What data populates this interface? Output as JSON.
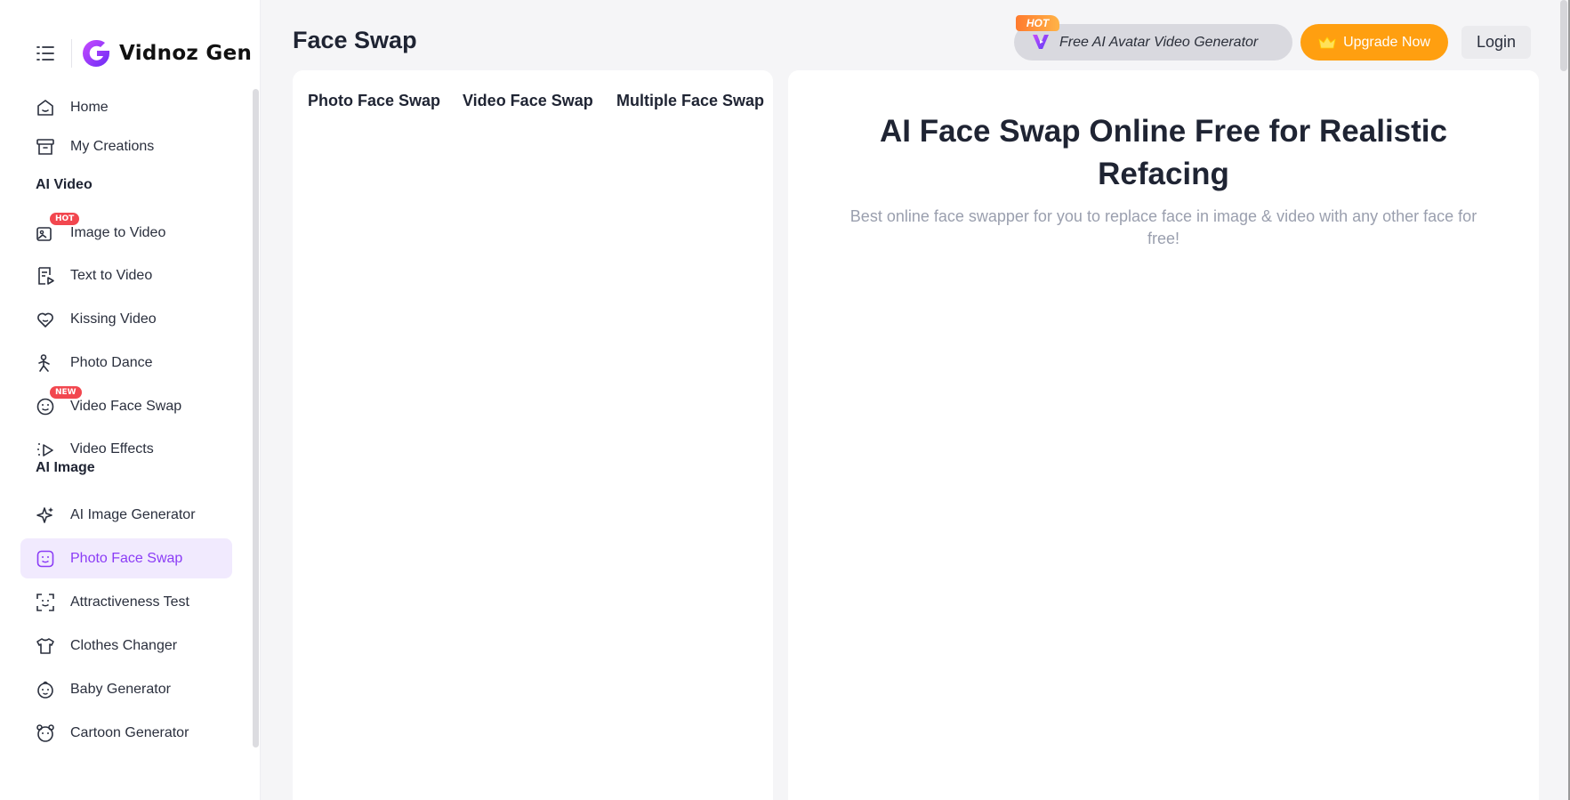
{
  "brand": {
    "name": "Vidnoz Gen"
  },
  "sidebar": {
    "items": [
      {
        "label": "Home",
        "icon": "home-icon"
      },
      {
        "label": "My Creations",
        "icon": "archive-icon"
      }
    ],
    "section_video": "AI Video",
    "video_items": [
      {
        "label": "Image to Video",
        "icon": "image-video-icon",
        "badge": "HOT"
      },
      {
        "label": "Text to Video",
        "icon": "text-video-icon"
      },
      {
        "label": "Kissing Video",
        "icon": "kiss-icon"
      },
      {
        "label": "Photo Dance",
        "icon": "dance-icon"
      },
      {
        "label": "Video Face Swap",
        "icon": "face-swap-video-icon",
        "badge": "NEW"
      },
      {
        "label": "Video Effects",
        "icon": "effects-icon"
      }
    ],
    "section_image": "AI Image",
    "image_items": [
      {
        "label": "AI Image Generator",
        "icon": "sparkle-icon"
      },
      {
        "label": "Photo Face Swap",
        "icon": "face-icon",
        "active": true
      },
      {
        "label": "Attractiveness Test",
        "icon": "face-scan-icon"
      },
      {
        "label": "Clothes Changer",
        "icon": "shirt-icon"
      },
      {
        "label": "Baby Generator",
        "icon": "baby-icon"
      },
      {
        "label": "Cartoon Generator",
        "icon": "cartoon-icon"
      }
    ]
  },
  "header": {
    "title": "Face Swap",
    "promo": {
      "hot": "HOT",
      "text": "Free AI Avatar Video Generator"
    },
    "upgrade": "Upgrade Now",
    "login": "Login"
  },
  "tabs": [
    "Photo Face Swap",
    "Video Face Swap",
    "Multiple Face Swap"
  ],
  "hero": {
    "title": "AI Face Swap Online Free for Realistic Refacing",
    "subtitle": "Best online face swapper for you to replace face in image & video with any other face for free!"
  },
  "colors": {
    "accent": "#8b3cf6",
    "upgrade": "#ff9f10",
    "badge": "#f2474f"
  }
}
